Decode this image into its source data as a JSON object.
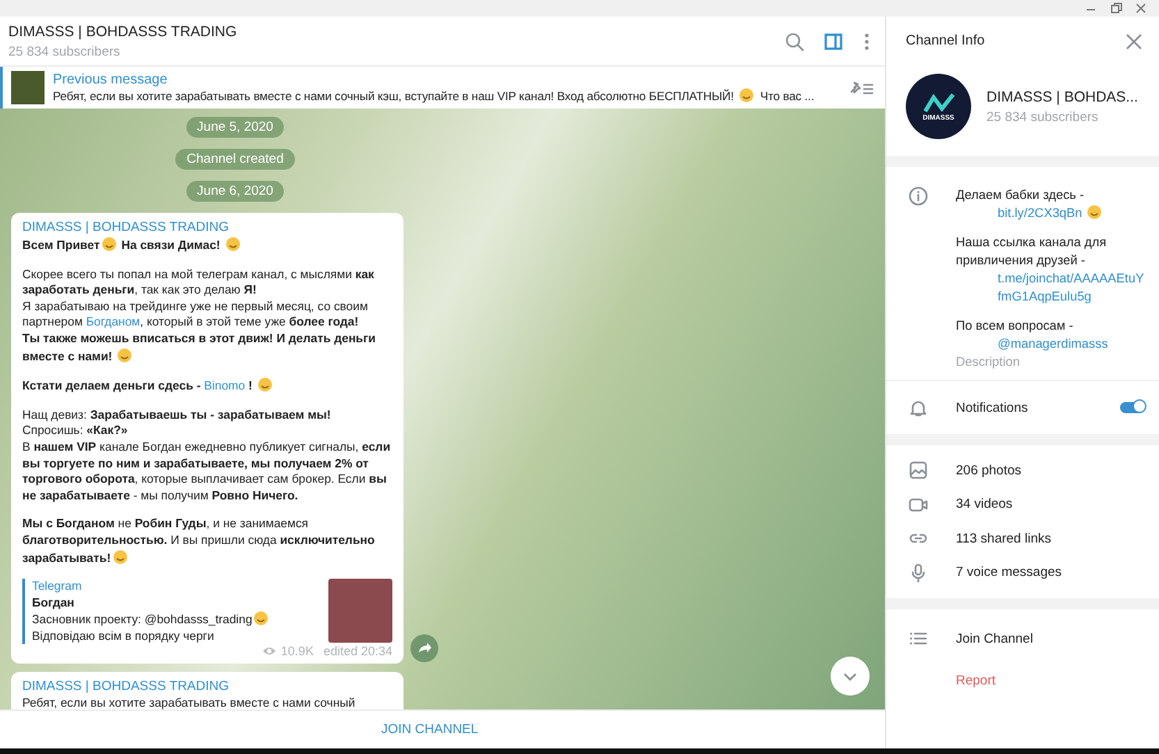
{
  "chat": {
    "title": "DIMASSS | BOHDASSS TRADING",
    "subtitle": "25 834 subscribers",
    "sidebar_open": true,
    "pinned": {
      "label": "Previous message",
      "text": "Ребят, если вы хотите зарабатывать вместе с нами сочный кэш, вступайте в наш VIP канал! Вход абсолютно БЕСПЛАТНЫЙ!",
      "text_after": "Что вас ..."
    },
    "service": [
      "June 5, 2020",
      "Channel created",
      "June 6, 2020"
    ],
    "messages": [
      {
        "sender": "DIMASSS | BOHDASSS TRADING",
        "paragraphs": [
          [
            [
              "**Всем Привет**",
              {
                "kind": "emoji"
              },
              " **На связи Димас!** ",
              {
                "kind": "emoji"
              }
            ]
          ],
          [
            [
              "Скорее всего ты попал на мой телеграм канал, с мыслями **как заработать деньги**, так как это делаю **Я!**"
            ],
            [
              "Я зарабатываю на трейдинге уже не первый месяц, со своим партнером ",
              {
                "kind": "link",
                "text": "Богданом"
              },
              ", который в этой теме уже **более года!**"
            ],
            [
              "**Ты также можешь вписаться в этот движ! И делать деньги вместе с нами!** ",
              {
                "kind": "emoji"
              }
            ]
          ],
          [
            [
              "**Кстати делаем деньги сдесь -** ",
              {
                "kind": "link",
                "text": "Binomo"
              },
              " **!** ",
              {
                "kind": "emoji"
              }
            ]
          ],
          [
            [
              "Нащ девиз: **Зарабатываешь ты - зарабатываем мы!** Спросишь: **«Как?»**"
            ],
            [
              "В **нашем VIP** канале Богдан ежедневно публикует сигналы, **если вы торгуете по ним и зарабатываете, мы получаем 2% от торгового оборота**, которые выплачивает сам брокер. Если **вы не зарабатываете** - мы получим **Ровно Ничего.**"
            ]
          ],
          [
            [
              "**Мы с Богданом** не **Робин Гуды**, и не занимаемся **благотворительностью.** И вы пришли сюда **исключительно зарабатывать!**",
              {
                "kind": "emoji"
              }
            ]
          ]
        ],
        "preview": {
          "site": "Telegram",
          "title": "Богдан",
          "lines": [
            "Засновник проекту: @bohdasss_trading",
            "Відповідаю всім в порядку черги"
          ]
        },
        "views": "10.9K",
        "time": "edited 20:34"
      },
      {
        "sender": "DIMASSS | BOHDASSS TRADING",
        "paragraphs": [
          [
            [
              "Ребят, если вы хотите зарабатывать вместе с нами сочный"
            ]
          ]
        ]
      }
    ],
    "join_button": "JOIN CHANNEL"
  },
  "info": {
    "title": "Channel Info",
    "logo_text": "DIMASSS",
    "name": "DIMASSS | BOHDAS...",
    "subscribers": "25 834 subscribers",
    "description": [
      {
        "text": "Делаем бабки здесь -",
        "link": "bit.ly/2CX3qBn",
        "emoji": true
      },
      {
        "text": "Наша ссылка канала для привличения друзей -",
        "link": "t.me/joinchat/AAAAAEtuYfmG1AqpEulu5g",
        "emoji": false
      },
      {
        "text": "По всем вопросам -",
        "link": "@managerdimasss",
        "emoji": false
      }
    ],
    "description_label": "Description",
    "notifications": {
      "label": "Notifications",
      "on": true
    },
    "media": [
      {
        "kind": "photos",
        "label": "206 photos"
      },
      {
        "kind": "videos",
        "label": "34 videos"
      },
      {
        "kind": "links",
        "label": "113 shared links"
      },
      {
        "kind": "voice",
        "label": "7 voice messages"
      }
    ],
    "actions": [
      {
        "kind": "join",
        "label": "Join Channel"
      },
      {
        "kind": "report",
        "label": "Report"
      }
    ]
  }
}
